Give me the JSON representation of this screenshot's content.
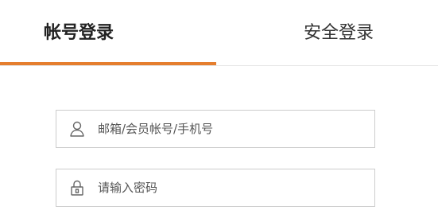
{
  "tabs": {
    "account_login": "帐号登录",
    "secure_login": "安全登录",
    "active": "account_login"
  },
  "form": {
    "username": {
      "icon": "user-icon",
      "placeholder": "邮箱/会员帐号/手机号",
      "value": ""
    },
    "password": {
      "icon": "lock-icon",
      "placeholder": "请输入密码",
      "value": ""
    }
  },
  "colors": {
    "accent": "#e57e2e",
    "border": "#cccccc",
    "text": "#333333"
  }
}
